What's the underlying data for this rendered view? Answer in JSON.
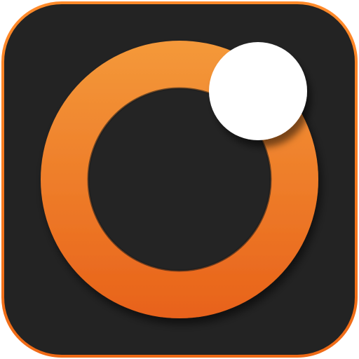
{
  "icon": {
    "name": "orange-ring-app-icon",
    "background_color": "#232323",
    "border_color_top": "#ff8a2a",
    "border_color_bottom": "#ef6a16",
    "ring_color_top": "#f4993a",
    "ring_color_bottom": "#e8621a",
    "ring_inner_color": "#242424",
    "dot_color": "#ffffff"
  }
}
